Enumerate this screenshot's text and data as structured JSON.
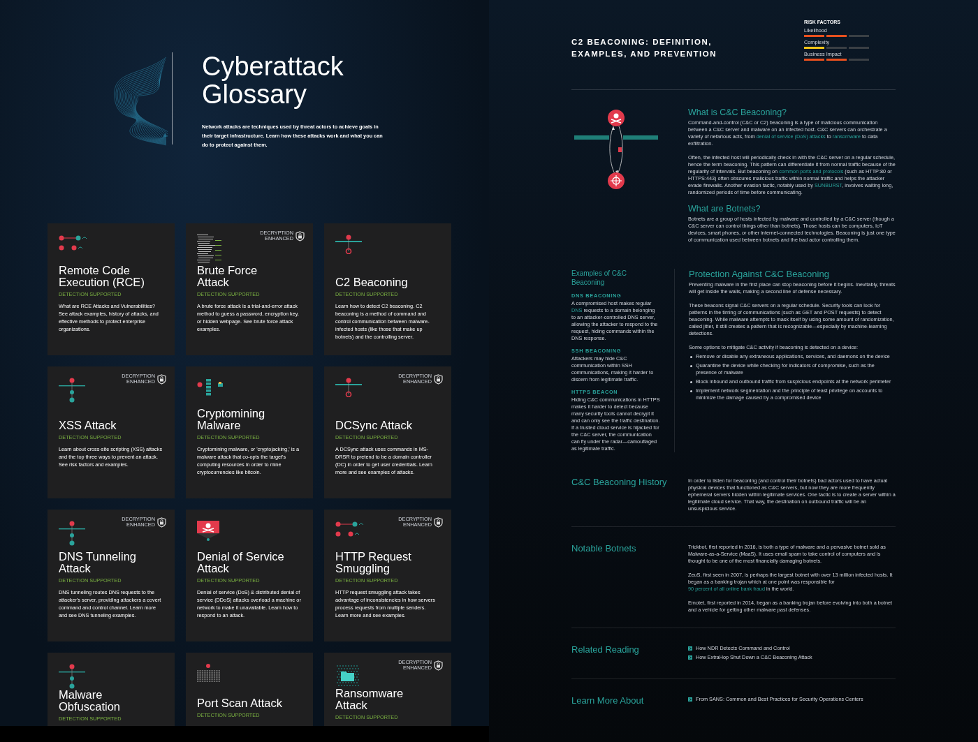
{
  "glossary": {
    "title": "Cyberattack Glossary",
    "intro": "Network attacks are techniques used by threat actors to achieve goals in their target infrastructure. Learn how these attacks work and what you can do to protect against them.",
    "cards": [
      {
        "title": "Remote Code\nExecution (RCE)",
        "detection": "DETECTION SUPPORTED",
        "description": "What are RCE Attacks and Vulnerabilities? See attack examples, history of attacks, and effective methods to protect enterprise organizations."
      },
      {
        "title": "Brute Force\nAttack",
        "badge": "DECRYPTION ENHANCED",
        "detection": "DETECTION SUPPORTED",
        "description": "A brute force attack is a trial-and-error attack method to guess a password, encryption key, or hidden webpage. See brute force attack examples."
      },
      {
        "title": "C2 Beaconing",
        "detection": "DETECTION SUPPORTED",
        "description": "Learn how to detect C2 beaconing. C2 beaconing is a method of command and control communication between malware-infected hosts (like those that make up botnets) and the controlling server."
      },
      {
        "title": "XSS Attack",
        "badge": "DECRYPTION ENHANCED",
        "detection": "DETECTION SUPPORTED",
        "description": "Learn about cross-site scripting (XSS) attacks and the top three ways to prevent an attack. See risk factors and examples."
      },
      {
        "title": "Cryptomining\nMalware",
        "detection": "DETECTION SUPPORTED",
        "description": "Cryptomining malware, or 'cryptojacking,' is a malware attack that co-opts the target's computing resources in order to mine cryptocurrencies like bitcoin."
      },
      {
        "title": "DCSync Attack",
        "badge": "DECRYPTION ENHANCED",
        "detection": "DETECTION SUPPORTED",
        "description": "A DCSync attack uses commands in MS-DRSR to pretend to be a domain controller (DC) in order to get user credentials. Learn more and see examples of attacks."
      },
      {
        "title": "DNS Tunneling\nAttack",
        "badge": "DECRYPTION ENHANCED",
        "detection": "DETECTION SUPPORTED",
        "description": "DNS tunneling routes DNS requests to the attacker's server, providing attackers a covert command and control channel. Learn more and see DNS tunneling examples."
      },
      {
        "title": "Denial of Service\nAttack",
        "detection": "DETECTION SUPPORTED",
        "description": "Denial of service (DoS) & distributed denial of service (DDoS) attacks overload a machine or network to make it unavailable. Learn how to respond to an attack."
      },
      {
        "title": "HTTP Request\nSmuggling",
        "badge": "DECRYPTION ENHANCED",
        "detection": "DETECTION SUPPORTED",
        "description": "HTTP request smuggling attack takes advantage of inconsistencies in how servers process requests from multiple senders. Learn more and see examples."
      },
      {
        "title": "Malware\nObfuscation",
        "detection": "DETECTION SUPPORTED"
      },
      {
        "title": "Port Scan Attack",
        "detection": "DETECTION SUPPORTED"
      },
      {
        "title": "Ransomware\nAttack",
        "badge": "DECRYPTION ENHANCED",
        "detection": "DETECTION SUPPORTED"
      }
    ]
  },
  "article": {
    "title": "C2 BEACONING: DEFINITION, EXAMPLES, AND PREVENTION",
    "risk_factors": {
      "heading": "RISK FACTORS",
      "factors": [
        {
          "label": "Likelihood",
          "level": 0.66,
          "color": "#e8501e"
        },
        {
          "label": "Complexity",
          "level": 0.33,
          "color": "#f2c418"
        },
        {
          "label": "Business Impact",
          "level": 0.66,
          "color": "#e8501e"
        }
      ]
    },
    "intro_sections": [
      {
        "heading": "What is C&C Beaconing?",
        "paragraphs": [
          [
            {
              "text": "Command-and-control (C&C or C2) beaconing is a type of malicious communication between a C&C server and malware on an infected host. C&C servers can orchestrate a variety of nefarious acts, from "
            },
            {
              "link": "denial of service (DoS) attacks"
            },
            {
              "text": " to "
            },
            {
              "link": "ransomware"
            },
            {
              "text": " to data exfiltration."
            }
          ],
          [
            {
              "text": "Often, the infected host will periodically check in with the C&C server on a regular schedule, hence the term beaconing. This pattern can differentiate it from normal traffic because of the regularity of intervals. But beaconing on "
            },
            {
              "link": "common ports and protocols"
            },
            {
              "text": " (such as HTTP:80 or HTTPS:443) often obscures malicious traffic within normal traffic and helps the attacker evade firewalls. Another evasion tactic, notably used by "
            },
            {
              "link": "SUNBURST"
            },
            {
              "text": ", involves waiting long, randomized periods of time before communicating."
            }
          ]
        ]
      },
      {
        "heading": "What are Botnets?",
        "paragraphs": [
          [
            {
              "text": "Botnets are a group of hosts infected by malware and controlled by a C&C server (though a C&C server can control things other than botnets). Those hosts can be computers, IoT devices, smart phones, or other internet-connected technologies. Beaconing is just one type of communication used between botnets and the bad actor controlling them."
            }
          ]
        ]
      }
    ],
    "examples": {
      "heading": "Examples of C&C Beaconing",
      "items": [
        {
          "subheading": "DNS BEACONING",
          "paragraph": [
            {
              "text": "A compromised host makes regular "
            },
            {
              "link": "DNS"
            },
            {
              "text": " requests to a domain belonging to an attacker-controlled DNS server, allowing the attacker to respond to the request, hiding commands within the DNS response."
            }
          ]
        },
        {
          "subheading": "SSH BEACONING",
          "paragraph": [
            {
              "text": "Attackers may hide C&C communication within SSH communications, making it harder to discern from legitimate traffic."
            }
          ]
        },
        {
          "subheading": "HTTPS BEACON",
          "paragraph": [
            {
              "text": "Hiding C&C communications in HTTPS makes it harder to detect because many security tools cannot decrypt it and can only see the traffic destination. If a trusted cloud service is hijacked for the C&C server, the communication can fly under the radar—camouflaged as legitimate traffic."
            }
          ]
        }
      ]
    },
    "protection": {
      "heading": "Protection Against C&C Beaconing",
      "paragraphs": [
        [
          {
            "text": "Preventing malware in the first place can stop beaconing before it begins. Inevitably, threats will get inside the walls, making a second line of defense necessary."
          }
        ],
        [
          {
            "text": "These beacons signal C&C servers on a regular schedule. Security tools can look for patterns in the timing of communications (such as GET and POST requests) to detect beaconing. While malware attempts to mask itself by using some amount of randomization, called jitter, it still creates a pattern that is recognizable—especially by machine-learning detections."
          }
        ],
        [
          {
            "text": "Some options to mitigate C&C activity if beaconing is detected on a device:"
          }
        ]
      ],
      "bullets": [
        "Remove or disable any extraneous applications, services, and daemons on the device",
        "Quarantine the device while checking for indicators of compromise, such as the presence of malware",
        "Block inbound and outbound traffic from suspicious endpoints at the network perimeter",
        "Implement network segmentation and the principle of least privilege on accounts to minimize the damage caused by a compromised device"
      ]
    },
    "rows": [
      {
        "heading": "C&C Beaconing History",
        "paragraphs": [
          [
            {
              "text": "In order to listen for beaconing (and control their botnets) bad actors used to have actual physical devices that functioned as C&C servers, but now they are more frequently ephemeral servers hidden within legitimate services. One tactic is to create a server within a legitimate cloud service. That way, the destination on outbound traffic will be an unsuspicious service."
            }
          ]
        ]
      },
      {
        "heading": "Notable Botnets",
        "paragraphs": [
          [
            {
              "text": "Trickbot, first reported in 2016, is both a type of malware and a pervasive botnet sold as Malware-as-a-Service (MaaS). It uses email spam to take control of computers and is thought to be one of the most financially damaging botnets."
            }
          ],
          [
            {
              "text": "ZeuS, first seen in 2007, is perhaps the largest botnet with over 13 million infected hosts. It began as a banking trojan which at one point was responsible for "
            },
            {
              "link": "90 percent of all online bank fraud"
            },
            {
              "text": " in the world."
            }
          ],
          [
            {
              "text": "Emotet, first reported in 2014, began as a banking trojan before evolving into both a botnet and a vehicle for getting other malware past defenses."
            }
          ]
        ]
      },
      {
        "heading": "Related Reading",
        "links": [
          "How NDR Detects Command and Control",
          "How ExtraHop Shut Down a C&C Beaconing Attack"
        ]
      },
      {
        "heading": "Learn More About",
        "links": [
          "From SANS: Common and Best Practices for Security Operations Centers"
        ]
      }
    ]
  }
}
